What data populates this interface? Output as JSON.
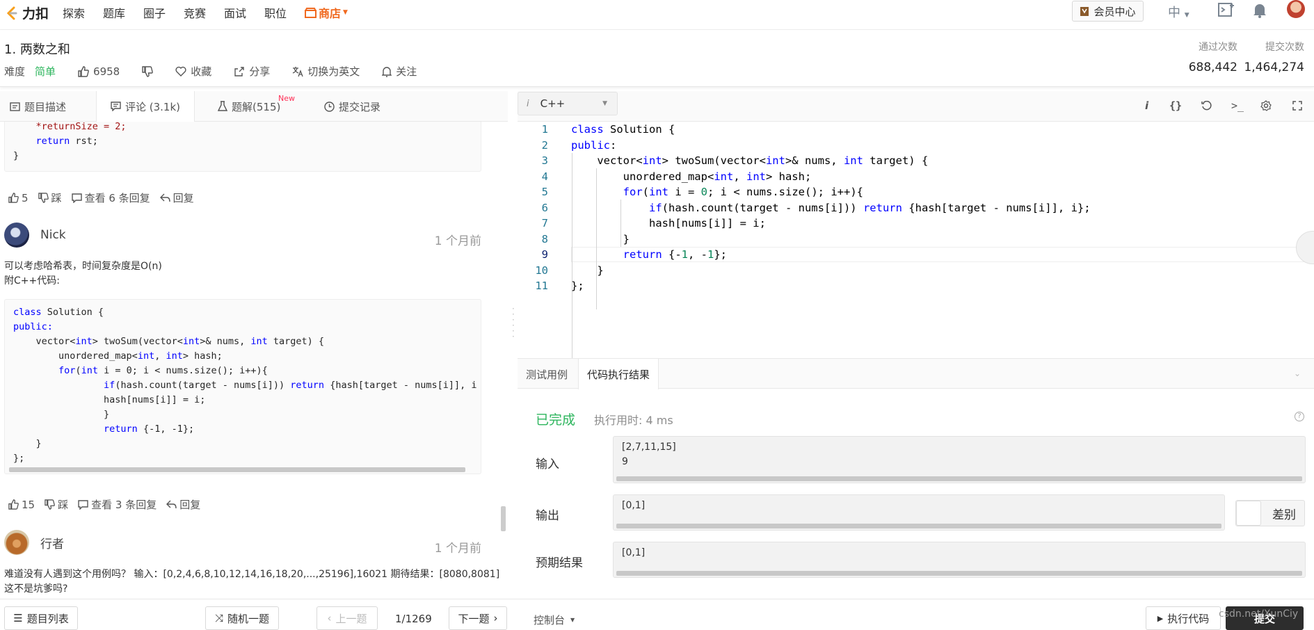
{
  "nav": {
    "logo_text": "力扣",
    "items": [
      "探索",
      "题库",
      "圈子",
      "竞赛",
      "面试",
      "职位"
    ],
    "shop": "商店",
    "vip": "会员中心",
    "lang": "中"
  },
  "problem": {
    "title": "1. 两数之和",
    "difficulty_label": "难度",
    "difficulty": "简单",
    "likes": "6958",
    "favorite": "收藏",
    "share": "分享",
    "switch_lang": "切换为英文",
    "follow": "关注",
    "accepted_label": "通过次数",
    "accepted": "688,442",
    "submissions_label": "提交次数",
    "submissions": "1,464,274"
  },
  "left_tabs": {
    "desc": "题目描述",
    "comments": "评论 (3.1k)",
    "solutions": "题解(515)",
    "new_badge": "New",
    "submissions": "提交记录"
  },
  "comments": {
    "prev_code": [
      "    *returnSize = 2;",
      "    return rst;",
      "}"
    ],
    "prev_actions": {
      "likes": "5",
      "dislike": "踩",
      "view_replies": "查看 6 条回复",
      "reply": "回复"
    },
    "c1": {
      "user": "Nick",
      "time": "1 个月前",
      "text1": "可以考虑哈希表，时间复杂度是O(n)",
      "text2": "附C++代码:",
      "code": [
        "class Solution {",
        "public:",
        "    vector<int> twoSum(vector<int>& nums, int target) {",
        "        unordered_map<int, int> hash;",
        "        for(int i = 0; i < nums.size(); i++){",
        "                if(hash.count(target - nums[i])) return {hash[target - nums[i]], i",
        "                hash[nums[i]] = i;",
        "                }",
        "                return {-1, -1};",
        "    }",
        "};"
      ],
      "likes": "15",
      "dislike": "踩",
      "view_replies": "查看 3 条回复",
      "reply": "回复"
    },
    "c2": {
      "user": "行者",
      "time": "1 个月前",
      "text1": "难道没有人遇到这个用例吗？ 输入：[0,2,4,6,8,10,12,14,16,18,20,...,25196],16021 期待结果：[8080,8081]",
      "text2": "这不是坑爹吗?"
    }
  },
  "editor": {
    "language": "C++",
    "lines": [
      "class Solution {",
      "public:",
      "    vector<int> twoSum(vector<int>& nums, int target) {",
      "        unordered_map<int, int> hash;",
      "        for(int i = 0; i < nums.size(); i++){",
      "            if(hash.count(target - nums[i])) return {hash[target - nums[i]], i};",
      "            hash[nums[i]] = i;",
      "        }",
      "        return {-1, -1};",
      "    }",
      "};"
    ],
    "line_numbers": [
      "1",
      "2",
      "3",
      "4",
      "5",
      "6",
      "7",
      "8",
      "9",
      "10",
      "11"
    ]
  },
  "console": {
    "tab_testcase": "测试用例",
    "tab_result": "代码执行结果",
    "status": "已完成",
    "runtime": "执行用时: 4 ms",
    "input_label": "输入",
    "input_line1": "[2,7,11,15]",
    "input_line2": "9",
    "output_label": "输出",
    "output": "[0,1]",
    "diff": "差别",
    "expected_label": "预期结果",
    "expected": "[0,1]"
  },
  "footer": {
    "problem_list": "题目列表",
    "random": "随机一题",
    "prev": "上一题",
    "page": "1/1269",
    "next": "下一题",
    "console": "控制台",
    "run": "执行代码",
    "submit": "提交"
  },
  "watermark": "csdn.net/XunCiy",
  "colors": {
    "easy": "#2db55d",
    "shop": "#f0691f",
    "submit_bg": "#2d2d2d"
  }
}
